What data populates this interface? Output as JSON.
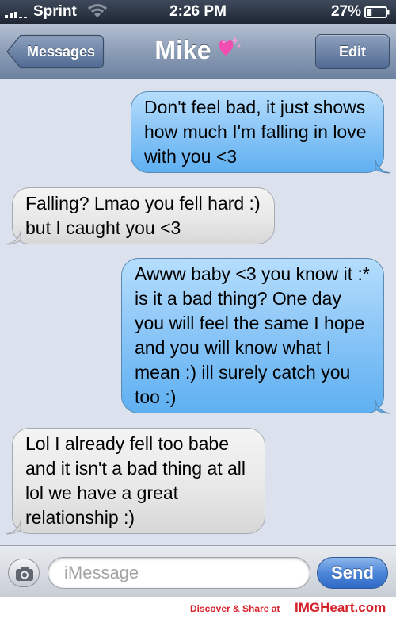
{
  "status_bar": {
    "carrier": "Sprint",
    "time": "2:26 PM",
    "battery_percent": "27%",
    "battery_level": 0.27,
    "signal_icon": "signal-bars-icon",
    "wifi_icon": "wifi-icon",
    "battery_icon": "battery-icon"
  },
  "nav": {
    "back_label": "Messages",
    "title": "Mike",
    "title_emoji": "sparkling-heart-icon",
    "edit_label": "Edit"
  },
  "messages": [
    {
      "direction": "sent",
      "text": "Don't feel bad, it just shows how much I'm falling in love with you <3"
    },
    {
      "direction": "received",
      "text": "Falling? Lmao you fell hard :) but I caught you <3"
    },
    {
      "direction": "sent",
      "text": "Awww baby <3 you know it :* is it a bad thing? One day you will feel the same I hope and you will know what I mean :) ill surely catch you too :)"
    },
    {
      "direction": "received",
      "text": "Lol I already fell too babe and it isn't a bad thing at all lol we have a great relationship :)"
    }
  ],
  "input_bar": {
    "camera_icon": "camera-icon",
    "placeholder": "iMessage",
    "send_label": "Send"
  },
  "footer": {
    "text": "Discover & Share at",
    "brand": "IMGHeart.com"
  },
  "colors": {
    "sent_bubble": "#8dc7f7",
    "received_bubble": "#e7e7e7",
    "send_button": "#4d86d8",
    "watermark": "#d4212a"
  }
}
